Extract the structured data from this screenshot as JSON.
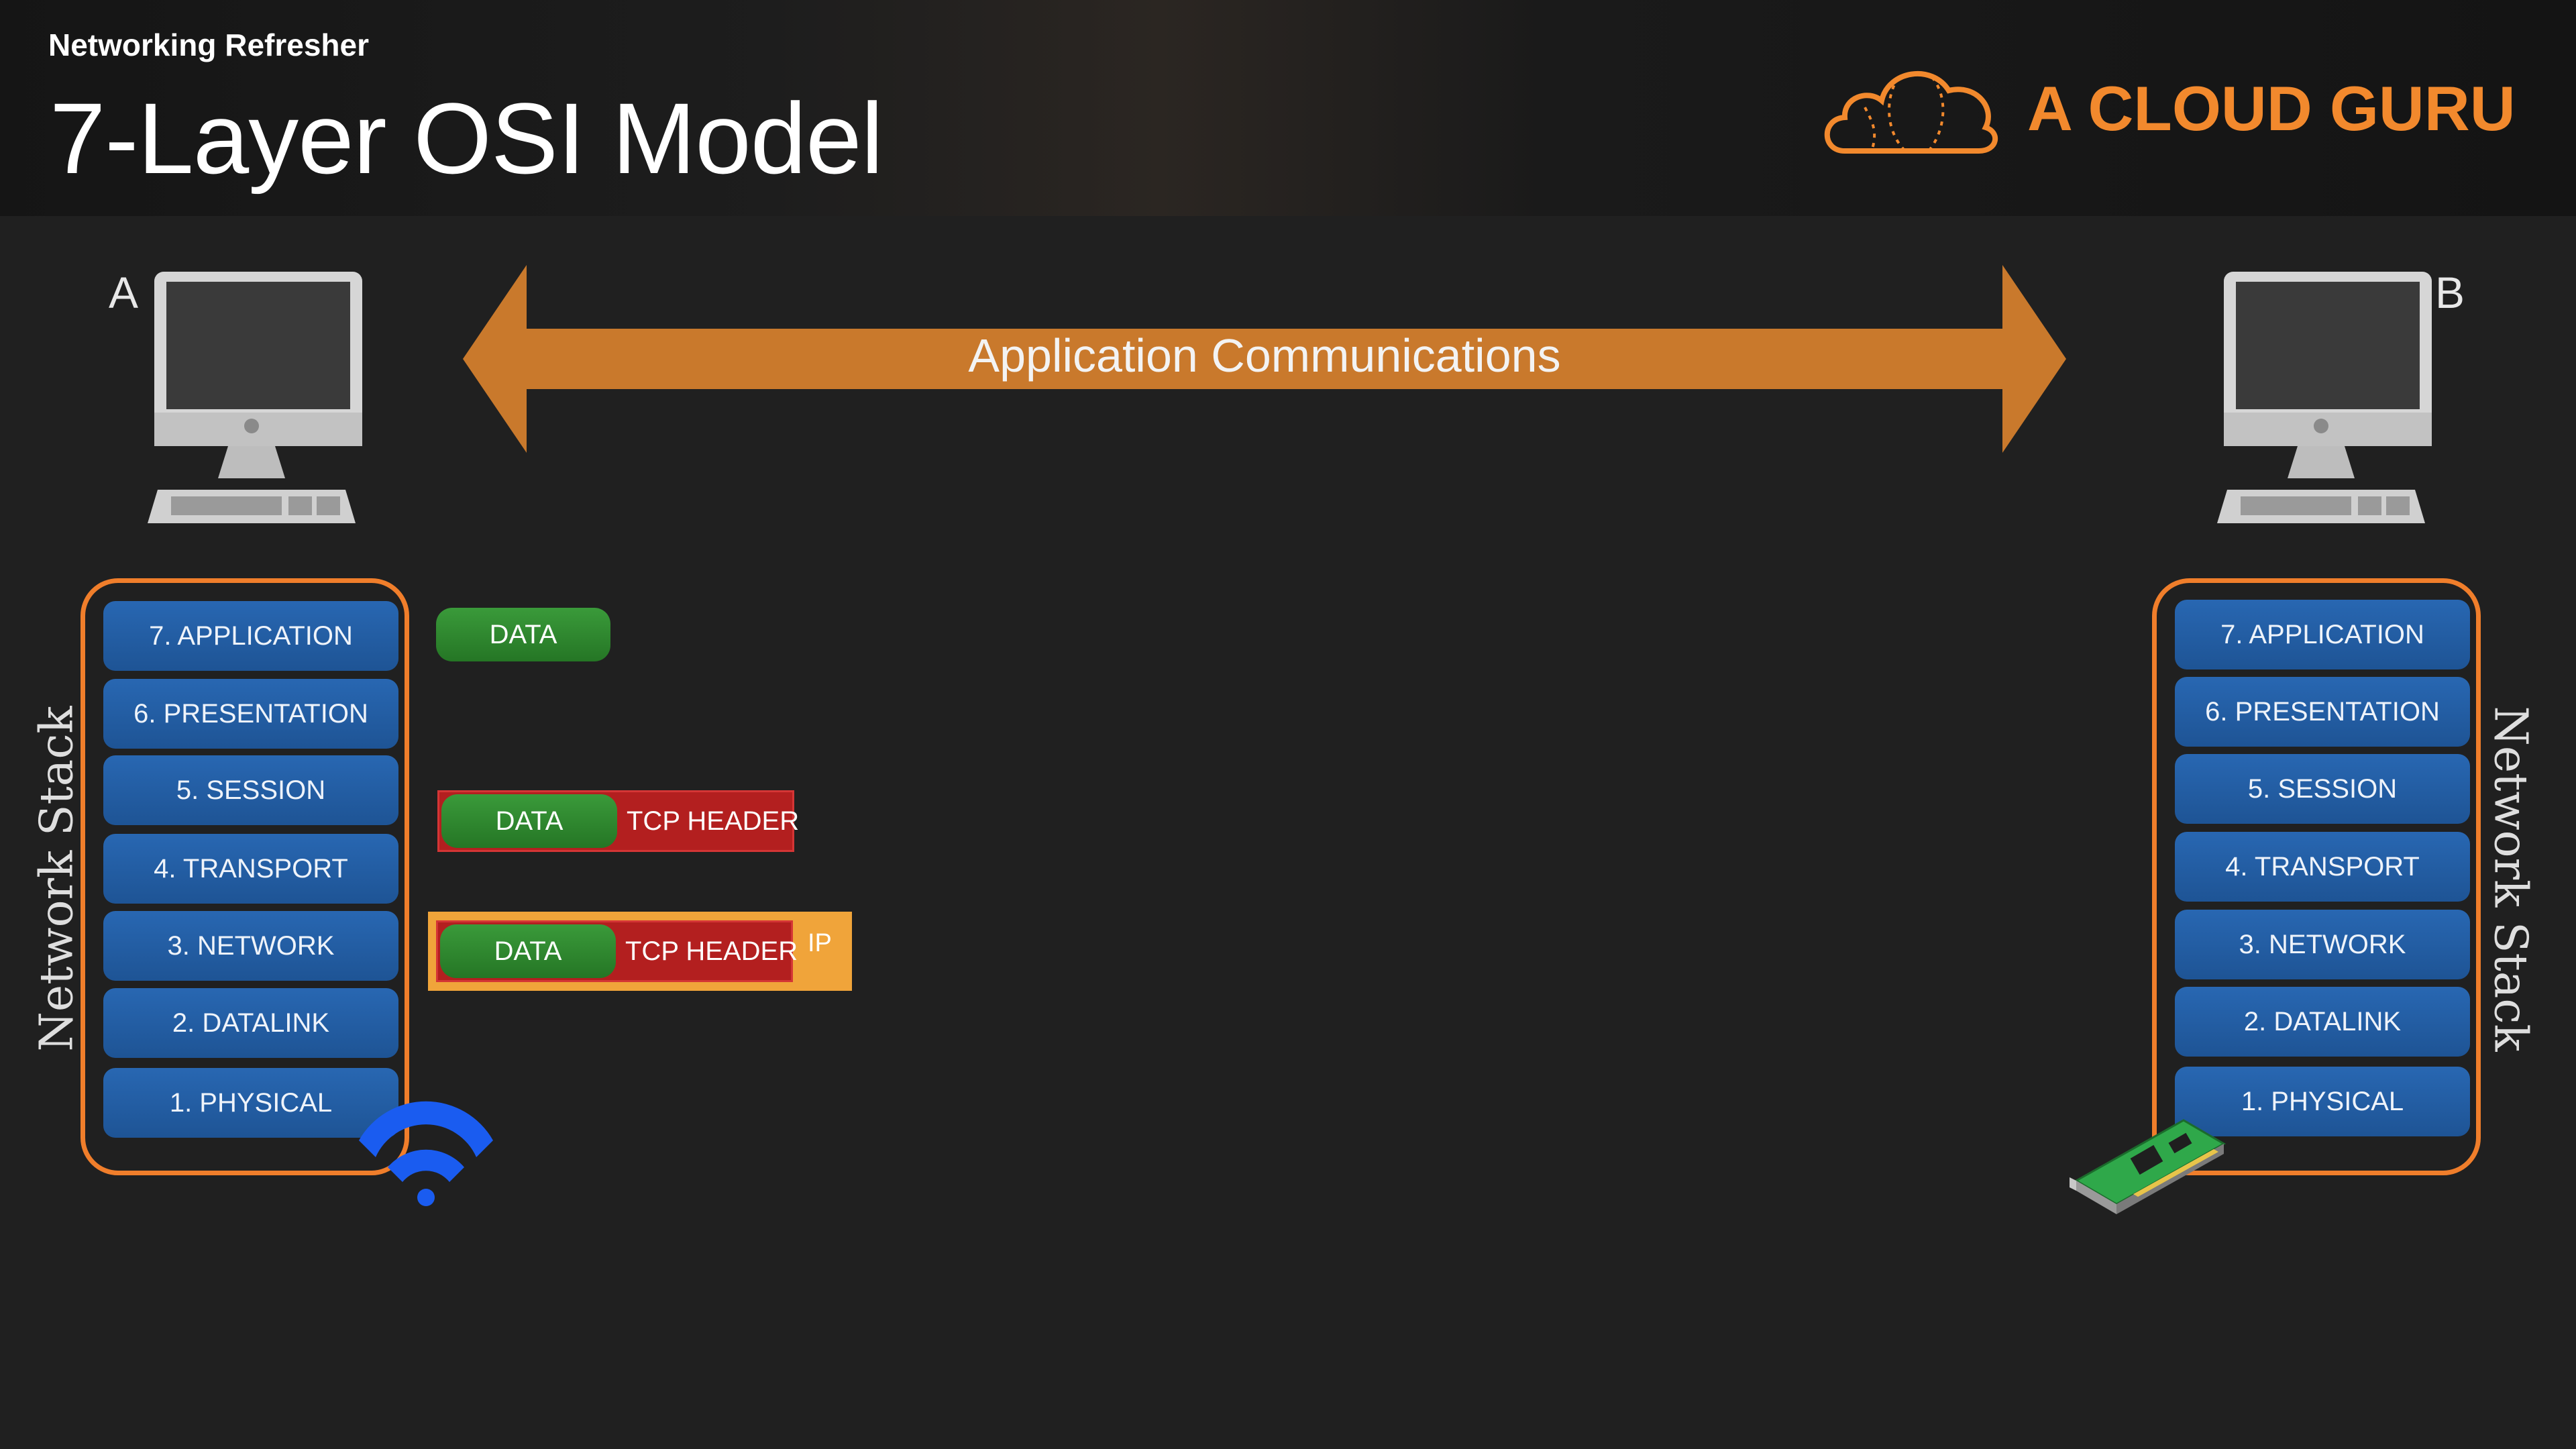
{
  "header": {
    "subtitle": "Networking Refresher",
    "title": "7-Layer OSI Model",
    "logo_text": "A CLOUD GURU",
    "logo_icon": "cloud-icon"
  },
  "arrow": {
    "label": "Application Communications",
    "icon": "double-arrow"
  },
  "computers": [
    {
      "label": "A",
      "icon": "desktop-computer-icon"
    },
    {
      "label": "B",
      "icon": "desktop-computer-icon"
    }
  ],
  "stacks": {
    "title": "Network Stack",
    "layers": [
      "7. APPLICATION",
      "6. PRESENTATION",
      "5. SESSION",
      "4. TRANSPORT",
      "3. NETWORK",
      "2. DATALINK",
      "1. PHYSICAL"
    ]
  },
  "pdus": {
    "data": "DATA",
    "tcp_header": "TCP HEADER",
    "ip": "IP"
  },
  "icons": {
    "wireless": "wifi-icon",
    "network_card": "network-card-icon"
  },
  "colors": {
    "accent_orange": "#f07e2b",
    "logo_orange": "#f2892d",
    "layer_blue": "#1e5495",
    "data_green": "#2b8a2b",
    "tcp_red": "#b31f1f",
    "ip_orange": "#f0a43a",
    "wifi_blue": "#1a5cf0"
  }
}
